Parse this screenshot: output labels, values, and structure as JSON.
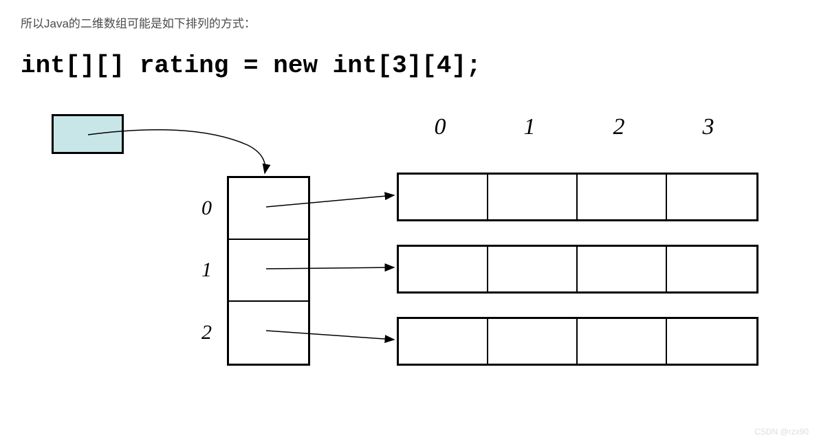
{
  "intro": "所以Java的二维数组可能是如下排列的方式：",
  "code": "int[][] rating = new int[3][4];",
  "outer_indices": [
    "0",
    "1",
    "2"
  ],
  "col_indices": [
    "0",
    "1",
    "2",
    "3"
  ],
  "watermark": "CSDN @rzx90"
}
